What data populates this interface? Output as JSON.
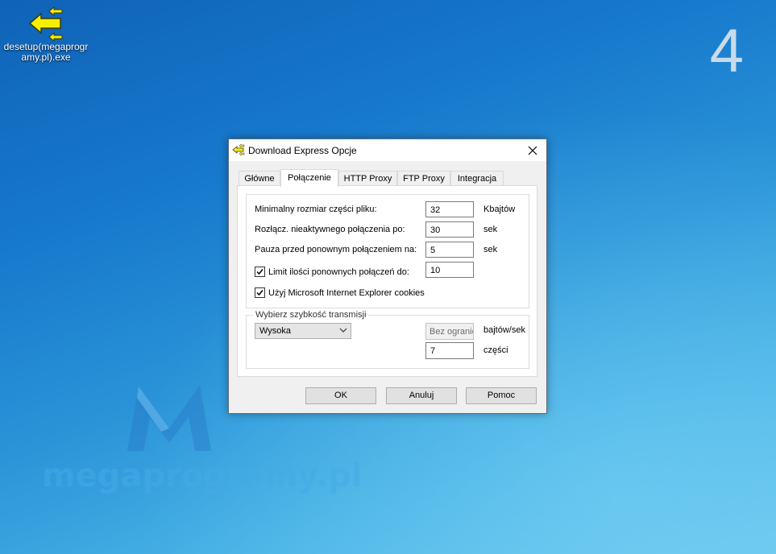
{
  "desktop": {
    "icon_label": "desetup(megaprogramy.pl).exe",
    "corner_number": "4",
    "watermark": "megaprogramy.pl"
  },
  "dialog": {
    "title": "Download Express Opcje",
    "tabs": [
      {
        "label": "Główne"
      },
      {
        "label": "Połączenie"
      },
      {
        "label": "HTTP Proxy"
      },
      {
        "label": "FTP Proxy"
      },
      {
        "label": "Integracja"
      }
    ],
    "active_tab": "Połączenie",
    "settings": {
      "min_part": {
        "label": "Minimalny rozmiar części pliku:",
        "value": "32",
        "unit": "Kbajtów"
      },
      "disconnect": {
        "label": "Rozłącz. nieaktywnego połączenia po:",
        "value": "30",
        "unit": "sek"
      },
      "pause": {
        "label": "Pauza przed ponownym połączeniem na:",
        "value": "5",
        "unit": "sek"
      },
      "limit": {
        "label": "Limit ilości ponownych połączeń do:",
        "value": "10",
        "checked": true
      },
      "ie_cookies": {
        "label": "Użyj Microsoft Internet Explorer cookies",
        "checked": true
      }
    },
    "speed": {
      "legend": "Wybierz szybkość transmisji",
      "selected": "Wysoka",
      "limit_value": "Bez ograniczeń",
      "limit_unit": "bajtów/sek",
      "parts_value": "7",
      "parts_unit": "części"
    },
    "buttons": {
      "ok": "OK",
      "cancel": "Anuluj",
      "help": "Pomoc"
    }
  }
}
